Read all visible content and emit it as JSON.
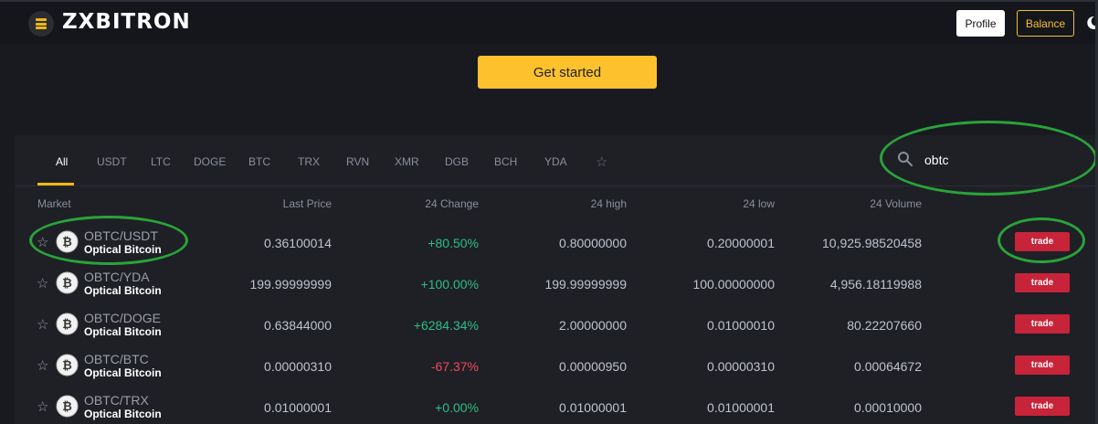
{
  "header": {
    "logo_text": "ZXBITRON",
    "profile_label": "Profile",
    "balance_label": "Balance"
  },
  "cta": {
    "label": "Get started"
  },
  "tabs": [
    "All",
    "USDT",
    "LTC",
    "DOGE",
    "BTC",
    "TRX",
    "RVN",
    "XMR",
    "DGB",
    "BCH",
    "YDA"
  ],
  "search": {
    "value": "obtc"
  },
  "table": {
    "headers": [
      "Market",
      "Last Price",
      "24 Change",
      "24 high",
      "24 low",
      "24 Volume"
    ],
    "rows": [
      {
        "pair": "OBTC/USDT",
        "name": "Optical Bitcoin",
        "last": "0.36100014",
        "change": "+80.50%",
        "high": "0.80000000",
        "low": "0.20000001",
        "volume": "10,925.98520458",
        "trade": "trade"
      },
      {
        "pair": "OBTC/YDA",
        "name": "Optical Bitcoin",
        "last": "199.99999999",
        "change": "+100.00%",
        "high": "199.99999999",
        "low": "100.00000000",
        "volume": "4,956.18119988",
        "trade": "trade"
      },
      {
        "pair": "OBTC/DOGE",
        "name": "Optical Bitcoin",
        "last": "0.63844000",
        "change": "+6284.34%",
        "high": "2.00000000",
        "low": "0.01000010",
        "volume": "80.22207660",
        "trade": "trade"
      },
      {
        "pair": "OBTC/BTC",
        "name": "Optical Bitcoin",
        "last": "0.00000310",
        "change": "-67.37%",
        "high": "0.00000950",
        "low": "0.00000310",
        "volume": "0.00064672",
        "trade": "trade"
      },
      {
        "pair": "OBTC/TRX",
        "name": "Optical Bitcoin",
        "last": "0.01000001",
        "change": "+0.00%",
        "high": "0.01000001",
        "low": "0.01000001",
        "volume": "0.00010000",
        "trade": "trade"
      }
    ]
  },
  "colors": {
    "accent": "#f0b90b",
    "positive": "#2ebd85",
    "negative": "#f6465d",
    "trade_button": "#c7243a",
    "annotation": "#2aa339"
  },
  "icons": [
    "logo-icon",
    "moon-icon",
    "star-icon",
    "search-icon",
    "coin-icon"
  ]
}
